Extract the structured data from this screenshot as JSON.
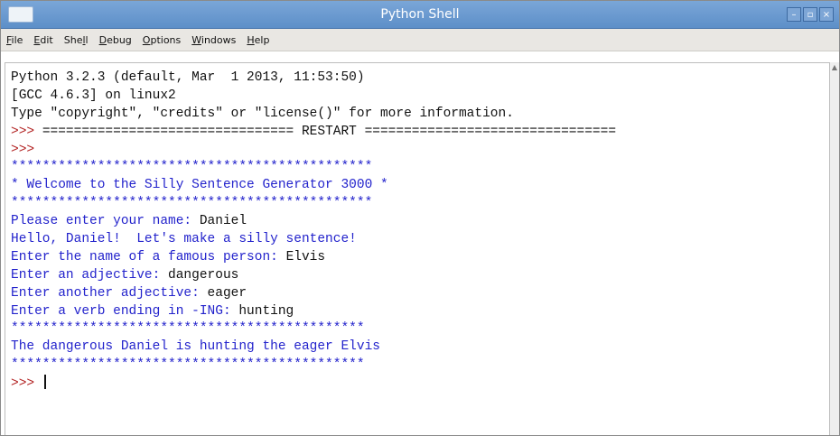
{
  "window": {
    "title": "Python Shell",
    "buttons": [
      "–",
      "▫",
      "×"
    ]
  },
  "menu": {
    "items": [
      {
        "first": "F",
        "rest": "ile"
      },
      {
        "first": "E",
        "rest": "dit"
      },
      {
        "pre": "She",
        "first": "l",
        "rest": "l"
      },
      {
        "first": "D",
        "rest": "ebug"
      },
      {
        "first": "O",
        "rest": "ptions"
      },
      {
        "first": "W",
        "rest": "indows"
      },
      {
        "first": "H",
        "rest": "elp"
      }
    ]
  },
  "shell": {
    "lines": [
      {
        "parts": [
          {
            "t": "Python 3.2.3 (default, Mar  1 2013, 11:53:50)",
            "c": "black"
          }
        ]
      },
      {
        "parts": [
          {
            "t": "[GCC 4.6.3] on linux2",
            "c": "black"
          }
        ]
      },
      {
        "parts": [
          {
            "t": "Type \"copyright\", \"credits\" or \"license()\" for more information.",
            "c": "black"
          }
        ]
      },
      {
        "parts": [
          {
            "t": ">>> ",
            "c": "red"
          },
          {
            "t": "================================ RESTART ================================",
            "c": "black"
          }
        ]
      },
      {
        "parts": [
          {
            "t": ">>>",
            "c": "red"
          }
        ]
      },
      {
        "parts": [
          {
            "t": "**********************************************",
            "c": "blue"
          }
        ]
      },
      {
        "parts": [
          {
            "t": "* Welcome to the Silly Sentence Generator 3000 *",
            "c": "blue"
          }
        ]
      },
      {
        "parts": [
          {
            "t": "**********************************************",
            "c": "blue"
          }
        ]
      },
      {
        "parts": [
          {
            "t": "Please enter your name: ",
            "c": "blue"
          },
          {
            "t": "Daniel",
            "c": "black"
          }
        ]
      },
      {
        "parts": [
          {
            "t": "Hello, Daniel!  Let's make a silly sentence!",
            "c": "blue"
          }
        ]
      },
      {
        "parts": [
          {
            "t": "Enter the name of a famous person: ",
            "c": "blue"
          },
          {
            "t": "Elvis",
            "c": "black"
          }
        ]
      },
      {
        "parts": [
          {
            "t": "Enter an adjective: ",
            "c": "blue"
          },
          {
            "t": "dangerous",
            "c": "black"
          }
        ]
      },
      {
        "parts": [
          {
            "t": "Enter another adjective: ",
            "c": "blue"
          },
          {
            "t": "eager",
            "c": "black"
          }
        ]
      },
      {
        "parts": [
          {
            "t": "Enter a verb ending in -ING: ",
            "c": "blue"
          },
          {
            "t": "hunting",
            "c": "black"
          }
        ]
      },
      {
        "parts": [
          {
            "t": "*********************************************",
            "c": "blue"
          }
        ]
      },
      {
        "parts": [
          {
            "t": "The dangerous Daniel is hunting the eager Elvis",
            "c": "blue"
          }
        ]
      },
      {
        "parts": [
          {
            "t": "*********************************************",
            "c": "blue"
          }
        ]
      },
      {
        "parts": [
          {
            "t": ">>> ",
            "c": "red"
          }
        ],
        "cursor": true
      }
    ]
  }
}
